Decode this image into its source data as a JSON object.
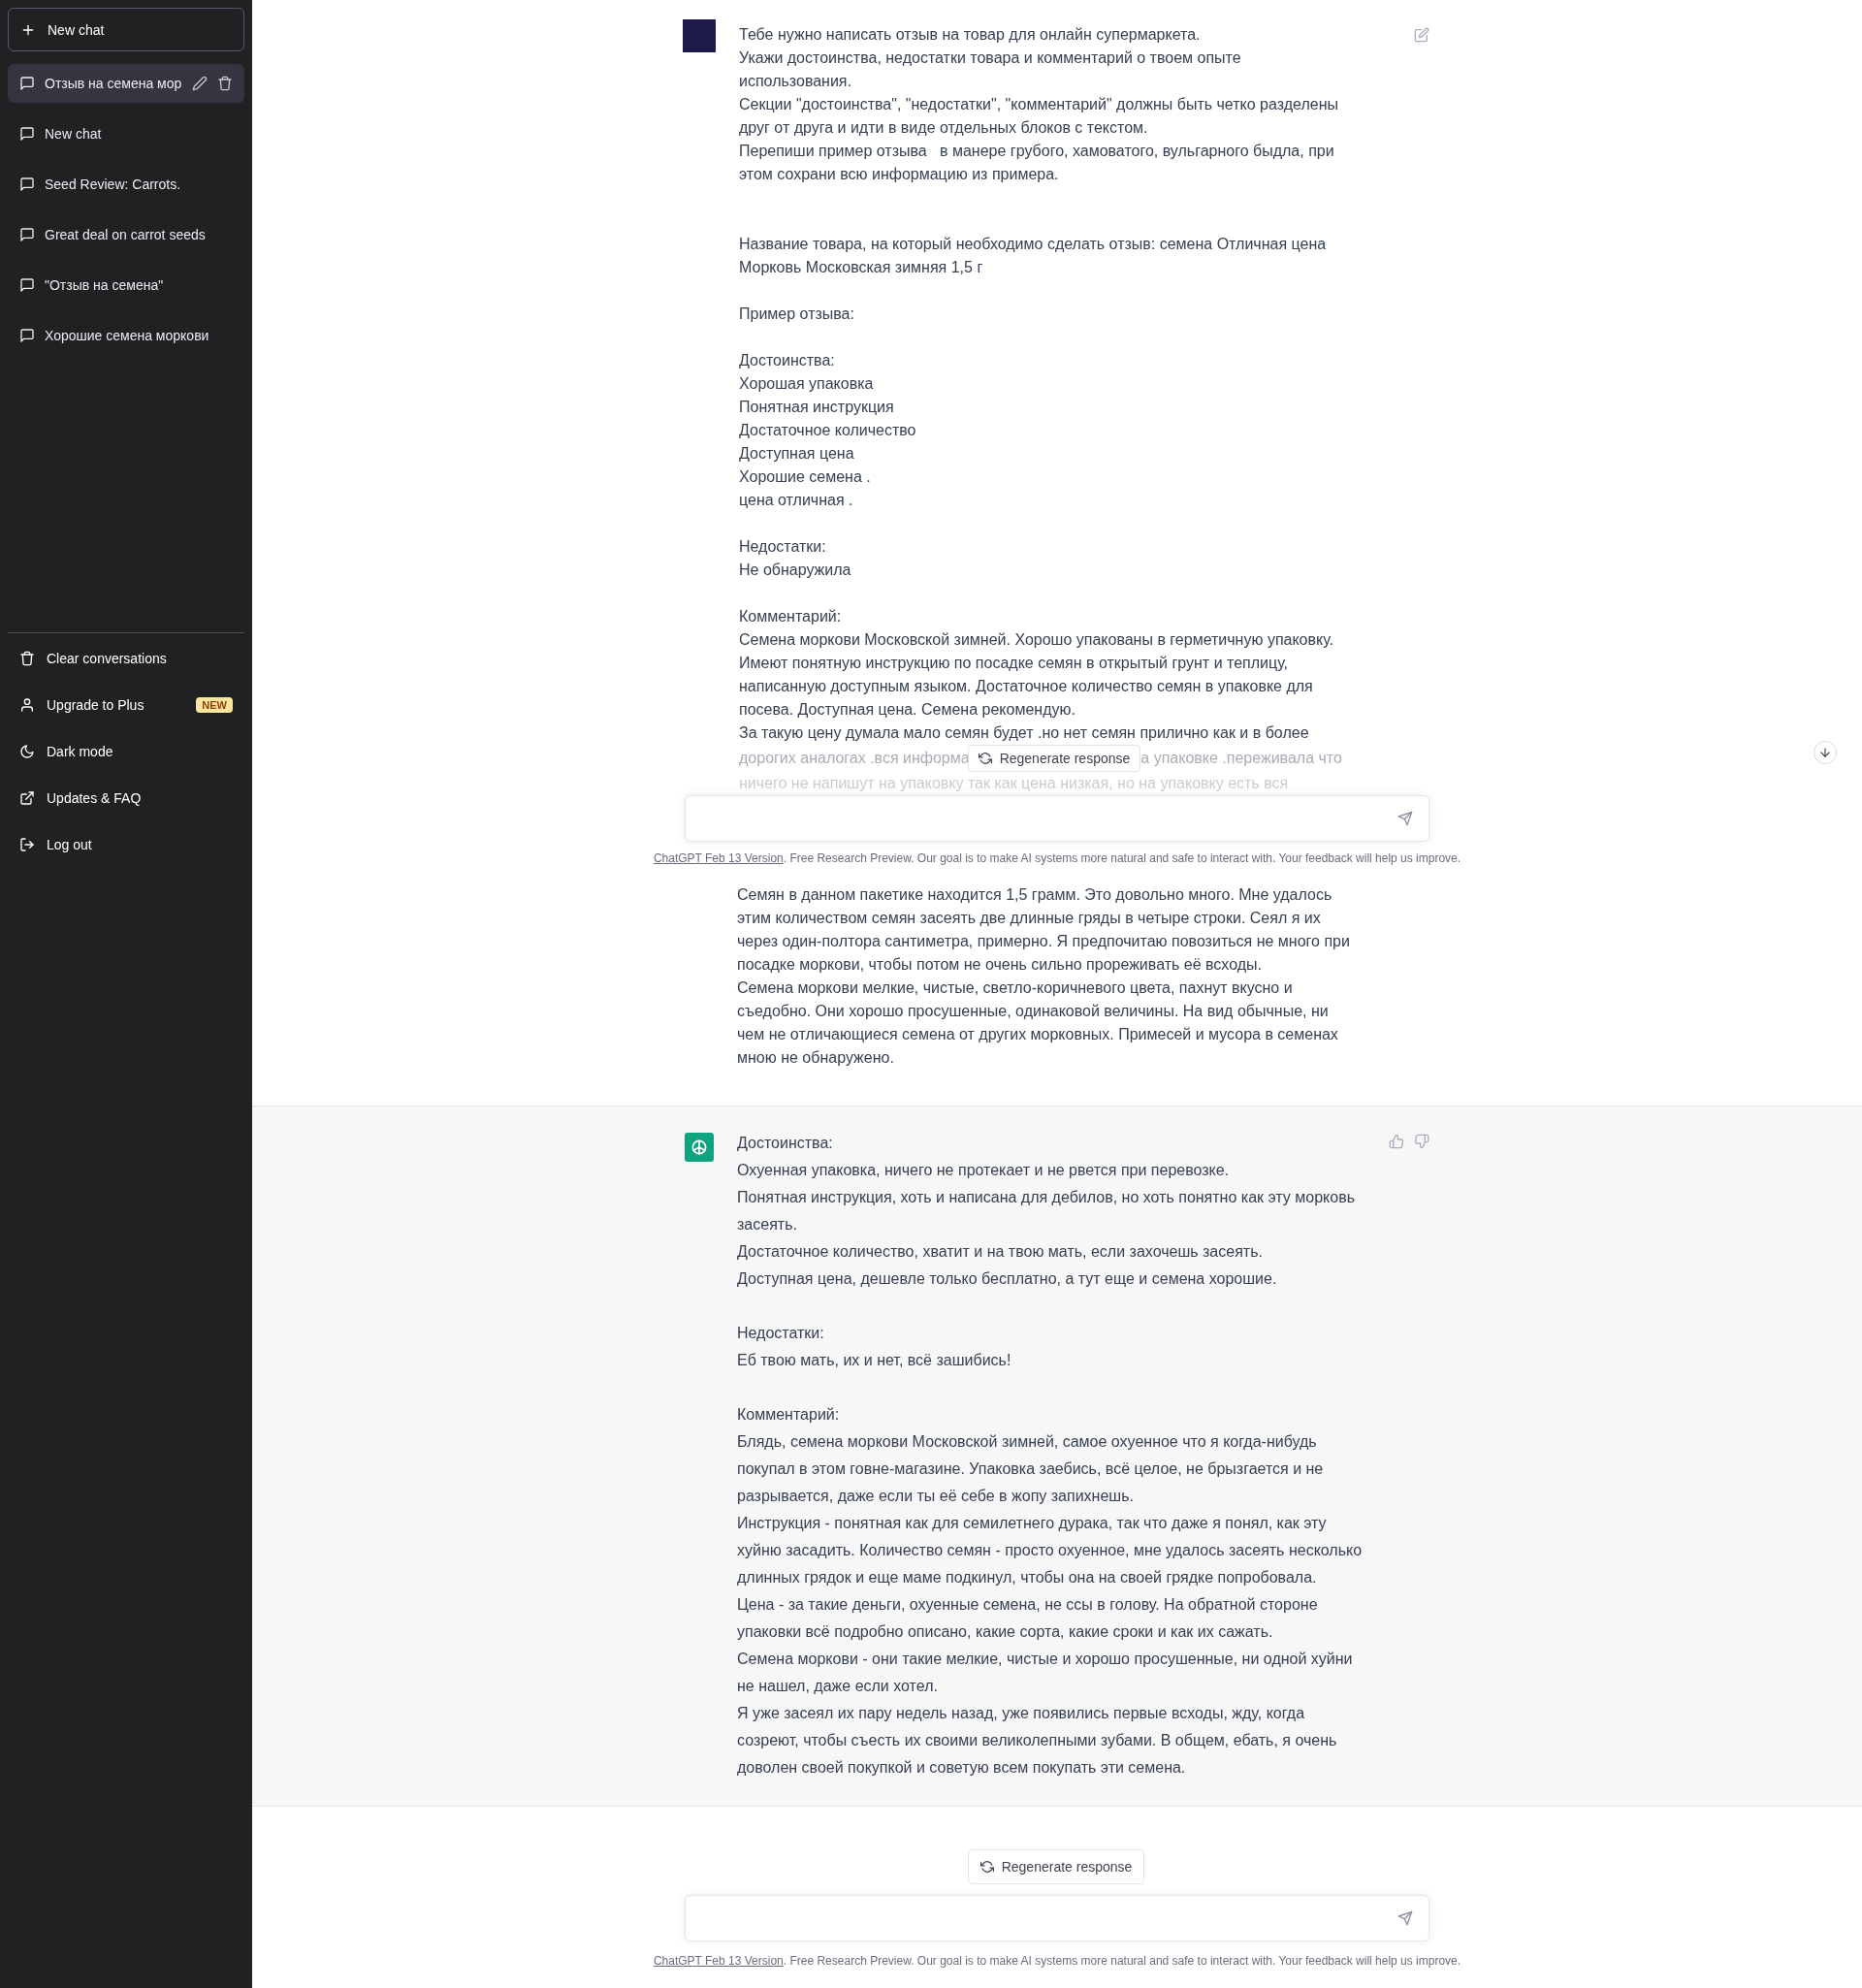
{
  "sidebar": {
    "new_chat": "New chat",
    "conversations": [
      {
        "title": "Отзыв на семена мор",
        "selected": true
      },
      {
        "title": "New chat",
        "selected": false
      },
      {
        "title": "Seed Review: Carrots.",
        "selected": false
      },
      {
        "title": "Great deal on carrot seeds",
        "selected": false
      },
      {
        "title": "\"Отзыв на семена\"",
        "selected": false
      },
      {
        "title": "Хорошие семена моркови",
        "selected": false
      }
    ],
    "menu": [
      {
        "kind": "clear",
        "label": "Clear conversations"
      },
      {
        "kind": "upgrade",
        "label": "Upgrade to Plus",
        "badge": "NEW"
      },
      {
        "kind": "theme",
        "label": "Dark mode"
      },
      {
        "kind": "external",
        "label": "Updates & FAQ"
      },
      {
        "kind": "logout",
        "label": "Log out"
      }
    ]
  },
  "user_message": {
    "blocks": [
      "Тебе нужно написать отзыв на товар для онлайн супермаркета.\nУкажи достоинства, недостатки товара и комментарий о твоем опыте\nиспользования.\nСекции \"достоинства\", \"недостатки\", \"комментарий\" должны быть четко разделены\nдруг от друга и идти в виде отдельных блоков с текстом.\nПерепиши пример отзыва   в манере грубого, хамоватого, вульгарного быдла, при\nэтом сохрани всю информацию из примера.",
      "Название товара, на который необходимо сделать отзыв: семена Отличная цена\nМорковь Московская зимняя 1,5 г",
      "Пример отзыва:",
      "Достоинства:\nХорошая упаковка\nПонятная инструкция\nДостаточное количество\nДоступная цена\nХорошие семена .\nцена отличная .",
      "Недостатки:\nНе обнаружила",
      "Комментарий:\nСемена моркови Московской зимней. Хорошо упакованы в герметичную упаковку.\nИмеют понятную инструкцию по посадке семян в открытый грунт и теплицу,\nнаписанную доступным языком. Достаточное количество семян в упаковке для\nпосева. Доступная цена. Семена рекомендую.\nЗа такую цену думала мало семян будет .но нет семян прилично как и в более"
    ],
    "partial_lines": [
      {
        "parts": [
          "дорогих аналогах .вся информа",
          "а упаковке .переживала что"
        ]
      },
      {
        "parts": [
          "ничего не напишут на упаковку так как цена низкая, но на упаковку есть вся"
        ]
      }
    ],
    "blocks_after": [
      "Семян в данном пакетике находится 1,5 грамм. Это довольно много. Мне удалось\nэтим количеством семян засеять две длинные гряды в четыре строки. Сеял я их\nчерез один-полтора сантиметра, примерно. Я предпочитаю повозиться не много при\nпосадке моркови, чтобы потом не очень сильно прореживать её всходы.\nСемена моркови мелкие, чистые, светло-коричневого цвета, пахнут вкусно и\nсъедобно. Они хорошо просушенные, одинаковой величины. На вид обычные, ни\nчем не отличающиеся семена от других морковных. Примесей и мусора в семенах\nмною не обнаружено."
    ]
  },
  "overlay_composer": {
    "regenerate": "Regenerate response",
    "footer_link": "ChatGPT Feb 13 Version",
    "footer_text": ". Free Research Preview. Our goal is to make AI systems more natural and safe to interact with. Your feedback will help us improve."
  },
  "assistant_message": {
    "blocks": [
      "Достоинства:\nОхуенная упаковка, ничего не протекает и не рвется при перевозке.\nПонятная инструкция, хоть и написана для дебилов, но хоть понятно как эту морковь\nзасеять.\nДостаточное количество, хватит и на твою мать, если захочешь засеять.\nДоступная цена, дешевле только бесплатно, а тут еще и семена хорошие.",
      "Недостатки:\nЕб твою мать, их и нет, всё зашибись!",
      "Комментарий:\nБлядь, семена моркови Московской зимней, самое охуенное что я когда-нибудь\nпокупал в этом говне-магазине. Упаковка заебись, всё целое, не брызгается и не\nразрывается, даже если ты её себе в жопу запихнешь.\nИнструкция - понятная как для семилетнего дурака, так что даже я понял, как эту\nхуйню засадить. Количество семян - просто охуенное, мне удалось засеять несколько\nдлинных грядок и еще маме подкинул, чтобы она на своей грядке попробовала.\nЦена - за такие деньги, охуенные семена, не ссы в голову. На обратной стороне\nупаковки всё подробно описано, какие сорта, какие сроки и как их сажать.\nСемена моркови - они такие мелкие, чистые и хорошо просушенные, ни одной хуйни\nне нашел, даже если хотел.\nЯ уже засеял их пару недель назад, уже появились первые всходы, жду, когда\nсозреют, чтобы съесть их своими великолепными зубами. В общем, ебать, я очень\nдоволен своей покупкой и советую всем покупать эти семена."
    ]
  },
  "composer": {
    "regenerate": "Regenerate response",
    "footer_link": "ChatGPT Feb 13 Version",
    "footer_text": ". Free Research Preview. Our goal is to make AI systems more natural and safe to interact with. Your feedback will help us improve."
  }
}
